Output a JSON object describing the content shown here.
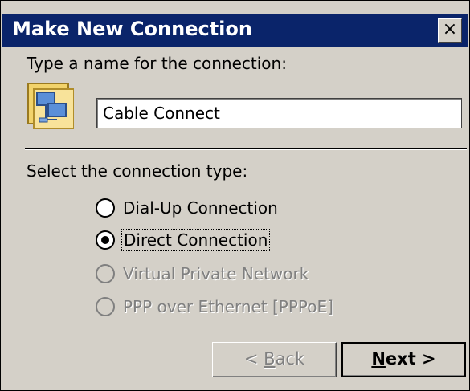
{
  "dialog": {
    "title": "Make New Connection",
    "close_glyph": "×",
    "name_label": "Type a name for the connection:",
    "name_value": "Cable Connect",
    "type_label": "Select the connection type:",
    "icon": "network-connection-icon"
  },
  "options": [
    {
      "label": "Dial-Up Connection",
      "checked": false,
      "disabled": false
    },
    {
      "label": "Direct Connection",
      "checked": true,
      "disabled": false
    },
    {
      "label": "Virtual Private Network",
      "checked": false,
      "disabled": true
    },
    {
      "label": "PPP over Ethernet [PPPoE]",
      "checked": false,
      "disabled": true
    }
  ],
  "buttons": {
    "back_prefix": "< ",
    "back_mnemonic": "B",
    "back_rest": "ack",
    "next_mnemonic": "N",
    "next_rest": "ext >"
  },
  "colors": {
    "titlebar": "#0a246a",
    "face": "#d4d0c8",
    "disabled_text": "#808080"
  }
}
